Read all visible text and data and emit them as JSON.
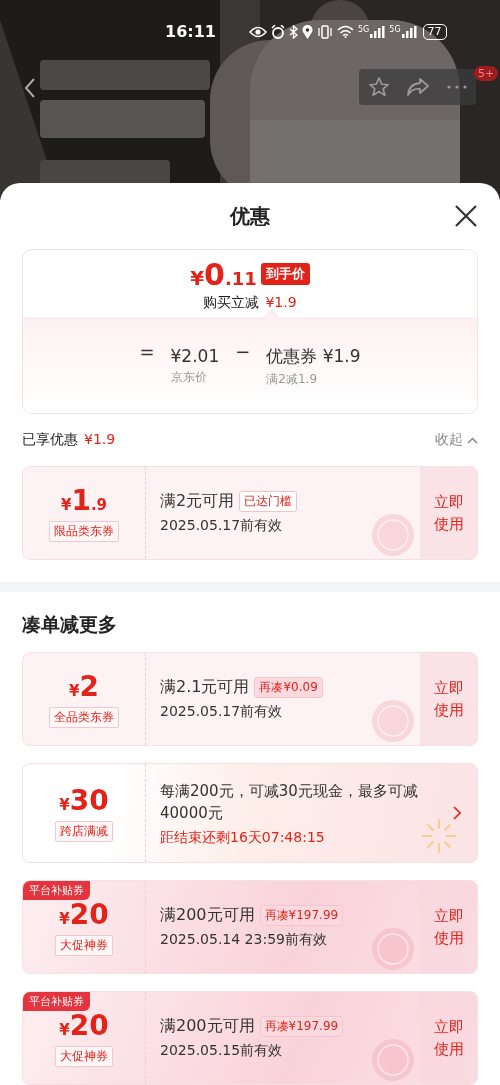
{
  "status_bar": {
    "time": "16:11",
    "network_labels": [
      "5G",
      "5G"
    ],
    "battery": "77"
  },
  "header": {
    "badge": "5+"
  },
  "sheet": {
    "title": "优惠"
  },
  "summary": {
    "currency": "¥",
    "price_integer": "0",
    "price_decimal": ".11",
    "price_tag": "到手价",
    "instant_label": "购买立减",
    "instant_amount": "¥1.9",
    "equals": "=",
    "jd_price": "¥2.01",
    "jd_label": "京东价",
    "minus": "−",
    "coupon_amount": "优惠券 ¥1.9",
    "coupon_rule": "满2减1.9"
  },
  "enjoyed": {
    "label": "已享优惠",
    "amount": "¥1.9",
    "toggle": "收起",
    "expanded": true
  },
  "claimed_coupons": [
    {
      "kind": "coupon",
      "currency": "¥",
      "amount": "1",
      "decimal": ".9",
      "type": "限品类东券",
      "condition": "满2元可用",
      "note": "已达门槛",
      "threshold_met": true,
      "validity": "2025.05.17前有效",
      "action": "立即使用",
      "claimed": true
    }
  ],
  "section_title": "凑单减更多",
  "more_coupons": [
    {
      "kind": "coupon",
      "currency": "¥",
      "amount": "2",
      "type": "全品类东券",
      "condition": "满2.1元可用",
      "note": "再凑¥0.09",
      "threshold_met": false,
      "validity": "2025.05.17前有效",
      "action": "立即使用",
      "claimed": true
    },
    {
      "kind": "promo",
      "currency": "¥",
      "amount": "30",
      "type": "跨店满减",
      "description": "每满200元，可减30元现金，最多可减40000元",
      "countdown": "距结束还剩16天07:48:15"
    },
    {
      "kind": "coupon",
      "ribbon": "平台补贴券",
      "currency": "¥",
      "amount": "20",
      "type": "大促神券",
      "condition": "满200元可用",
      "note": "再凑¥197.99",
      "threshold_met": false,
      "validity": "2025.05.14 23:59前有效",
      "action": "立即使用",
      "claimed": true
    },
    {
      "kind": "coupon",
      "ribbon": "平台补贴券",
      "currency": "¥",
      "amount": "20",
      "type": "大促神券",
      "condition": "满200元可用",
      "note": "再凑¥197.99",
      "threshold_met": false,
      "validity": "2025.05.15前有效",
      "action": "立即使用",
      "claimed": true
    }
  ]
}
